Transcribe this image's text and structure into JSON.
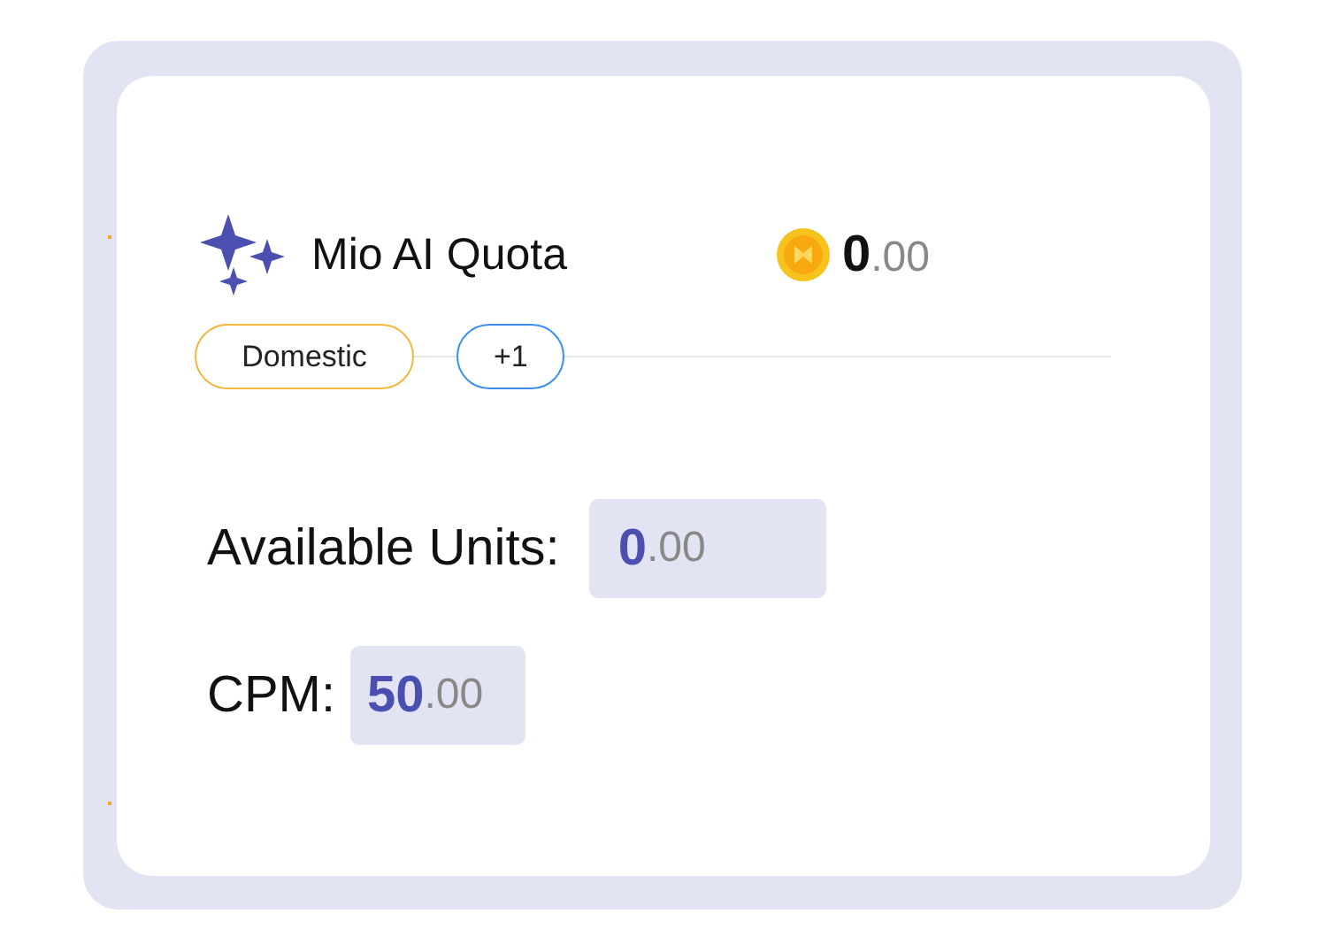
{
  "title": "Mio AI Quota",
  "balance": {
    "integer": "0",
    "decimal": ".00"
  },
  "tags": [
    {
      "label": "Domestic",
      "color": "#f5b73b"
    },
    {
      "label": "+1",
      "color": "#3b8ef5"
    }
  ],
  "fields": [
    {
      "label": "Available Units:",
      "integer": "0",
      "decimal": ".00"
    },
    {
      "label": "CPM:",
      "integer": "50",
      "decimal": ".00"
    }
  ]
}
